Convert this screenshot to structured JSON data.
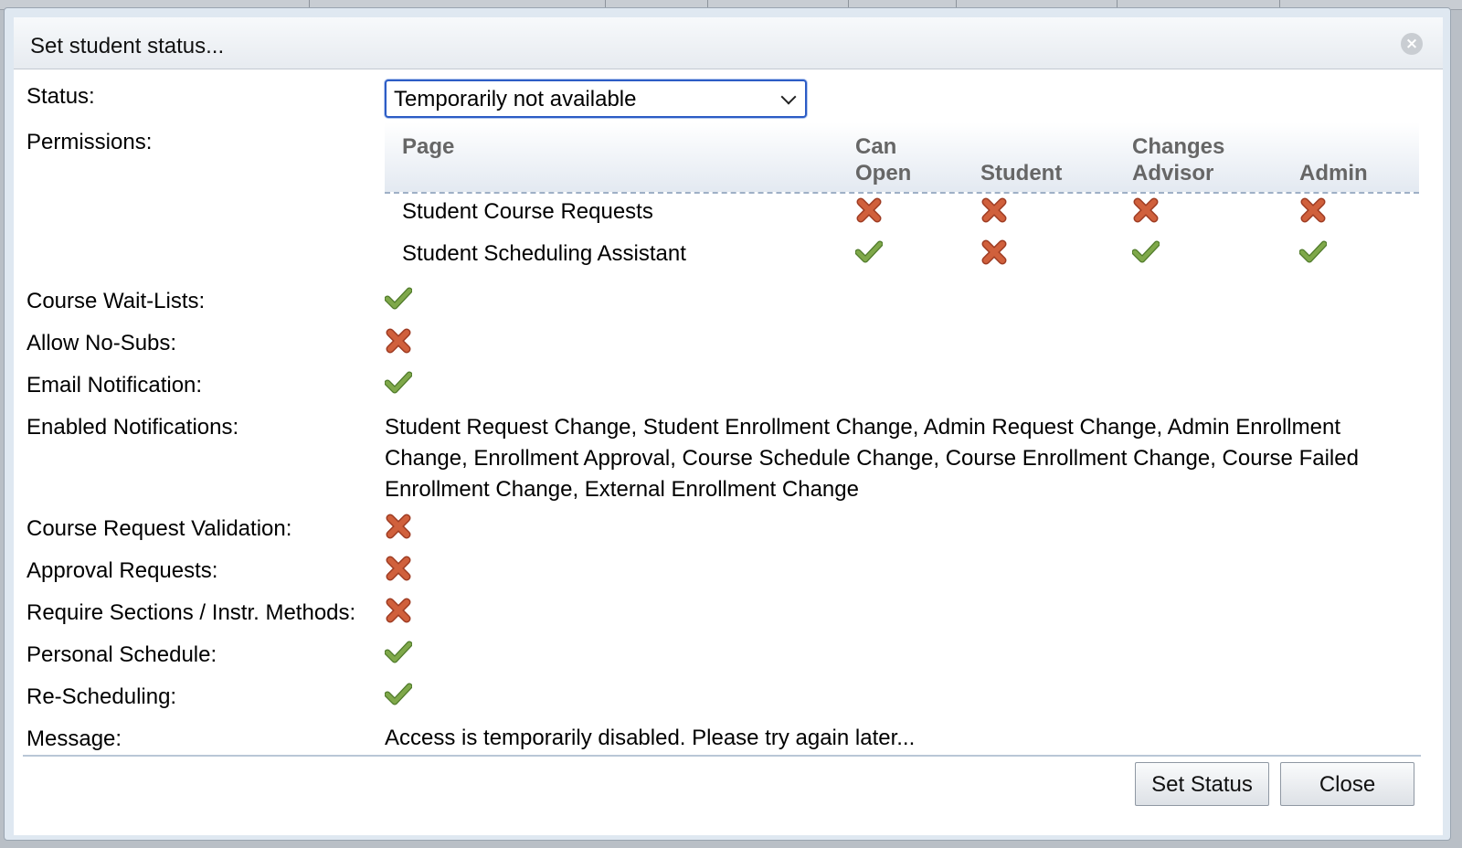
{
  "dialog": {
    "title": "Set student status...",
    "close_glyph": "×"
  },
  "labels": {
    "status": "Status:",
    "permissions": "Permissions:",
    "wait_lists": "Course Wait-Lists:",
    "no_subs": "Allow No-Subs:",
    "email": "Email Notification:",
    "enabled_notifications": "Enabled Notifications:",
    "course_request_validation": "Course Request Validation:",
    "approval_requests": "Approval Requests:",
    "require_sections": "Require Sections / Instr. Methods:",
    "personal_schedule": "Personal Schedule:",
    "rescheduling": "Re-Scheduling:",
    "message": "Message:"
  },
  "status_select": {
    "value": "Temporarily not available"
  },
  "permissions": {
    "headers": {
      "page": "Page",
      "can_open_1": "Can",
      "can_open_2": "Open",
      "student": "Student",
      "changes_advisor_1": "Changes",
      "changes_advisor_2": "Advisor",
      "admin": "Admin"
    },
    "rows": [
      {
        "page": "Student Course Requests",
        "can_open": "no",
        "student": "no",
        "changes_advisor": "no",
        "admin": "no"
      },
      {
        "page": "Student Scheduling Assistant",
        "can_open": "yes",
        "student": "no",
        "changes_advisor": "yes",
        "admin": "yes"
      }
    ]
  },
  "values": {
    "wait_lists": "yes",
    "no_subs": "no",
    "email": "yes",
    "enabled_notifications": "Student Request Change, Student Enrollment Change, Admin Request Change, Admin Enrollment Change, Enrollment Approval, Course Schedule Change, Course Enrollment Change, Course Failed Enrollment Change, External Enrollment Change",
    "course_request_validation": "no",
    "approval_requests": "no",
    "require_sections": "no",
    "personal_schedule": "yes",
    "rescheduling": "yes",
    "message": "Access is temporarily disabled. Please try again later..."
  },
  "buttons": {
    "set_status": "Set Status",
    "close": "Close"
  },
  "colors": {
    "check": "#7fa84a",
    "cross": "#d0603c"
  }
}
